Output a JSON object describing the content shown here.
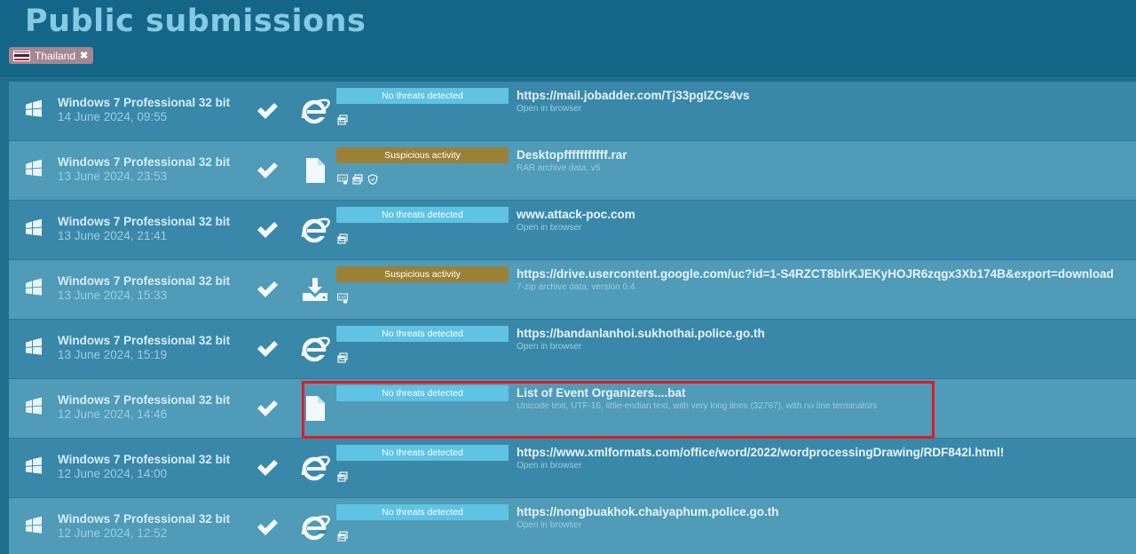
{
  "page": {
    "title": "Public submissions"
  },
  "filter": {
    "country": "Thailand"
  },
  "submissions": [
    {
      "os": "Windows 7 Professional 32 bit",
      "date": "14 June 2024, 09:55",
      "type_icon": "ie-icon",
      "verdict": "No threats detected",
      "verdict_kind": "clean",
      "tags": [
        "window-icon"
      ],
      "subject": "https://mail.jobadder.com/Tj33pgIZCs4vs",
      "subtype": "Open in browser"
    },
    {
      "os": "Windows 7 Professional 32 bit",
      "date": "13 June 2024, 23:53",
      "type_icon": "file-icon",
      "verdict": "Suspicious activity",
      "verdict_kind": "suspicious",
      "tags": [
        "exe-icon",
        "window-icon",
        "shield-icon"
      ],
      "subject": "Desktopfffffffffff.rar",
      "subtype": "RAR archive data, v5"
    },
    {
      "os": "Windows 7 Professional 32 bit",
      "date": "13 June 2024, 21:41",
      "type_icon": "ie-icon",
      "verdict": "No threats detected",
      "verdict_kind": "clean",
      "tags": [
        "window-icon"
      ],
      "subject": "www.attack-poc.com",
      "subtype": "Open in browser"
    },
    {
      "os": "Windows 7 Professional 32 bit",
      "date": "13 June 2024, 15:33",
      "type_icon": "download-icon",
      "verdict": "Suspicious activity",
      "verdict_kind": "suspicious",
      "tags": [
        "exe-icon"
      ],
      "subject": "https://drive.usercontent.google.com/uc?id=1-S4RZCT8blrKJEKyHOJR6zqgx3Xb174B&export=download",
      "subtype": "7-zip archive data, version 0.4"
    },
    {
      "os": "Windows 7 Professional 32 bit",
      "date": "13 June 2024, 15:19",
      "type_icon": "ie-icon",
      "verdict": "No threats detected",
      "verdict_kind": "clean",
      "tags": [
        "window-icon"
      ],
      "subject": "https://bandanlanhoi.sukhothai.police.go.th",
      "subtype": "Open in browser"
    },
    {
      "os": "Windows 7 Professional 32 bit",
      "date": "12 June 2024, 14:46",
      "type_icon": "file-icon",
      "verdict": "No threats detected",
      "verdict_kind": "clean",
      "tags": [],
      "subject": "List of Event Organizers....bat",
      "subtype": "Unicode text, UTF-16, little-endian text, with very long lines (32767), with no line terminators"
    },
    {
      "os": "Windows 7 Professional 32 bit",
      "date": "12 June 2024, 14:00",
      "type_icon": "ie-icon",
      "verdict": "No threats detected",
      "verdict_kind": "clean",
      "tags": [
        "window-icon"
      ],
      "subject": "https://www.xmlformats.com/office/word/2022/wordprocessingDrawing/RDF842l.html!",
      "subtype": "Open in browser"
    },
    {
      "os": "Windows 7 Professional 32 bit",
      "date": "12 June 2024, 12:52",
      "type_icon": "ie-icon",
      "verdict": "No threats detected",
      "verdict_kind": "clean",
      "tags": [
        "window-icon"
      ],
      "subject": "https://nongbuakhok.chaiyaphum.police.go.th",
      "subtype": "Open in browser"
    }
  ],
  "colors": {
    "header": "#146688",
    "row_odd": "#3a88a9",
    "row_even": "#4f9bb8",
    "clean": "#5fc3e3",
    "suspicious": "#9a8137",
    "highlight": "#e01b24"
  }
}
